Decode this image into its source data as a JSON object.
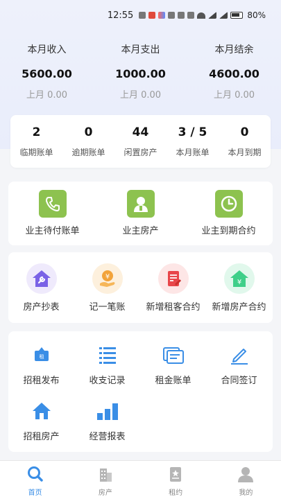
{
  "status_bar": {
    "time": "12:55",
    "battery": "80%"
  },
  "summary": [
    {
      "label": "本月收入",
      "amount": "5600.00",
      "last": "上月 0.00"
    },
    {
      "label": "本月支出",
      "amount": "1000.00",
      "last": "上月 0.00"
    },
    {
      "label": "本月结余",
      "amount": "4600.00",
      "last": "上月 0.00"
    }
  ],
  "stats": [
    {
      "value": "2",
      "label": "临期账单"
    },
    {
      "value": "0",
      "label": "逾期账单"
    },
    {
      "value": "44",
      "label": "闲置房产"
    },
    {
      "value": "3 / 5",
      "label": "本月账单"
    },
    {
      "value": "0",
      "label": "本月到期"
    }
  ],
  "owner_actions": [
    {
      "label": "业主待付账单",
      "icon": "phone-icon"
    },
    {
      "label": "业主房产",
      "icon": "person-icon"
    },
    {
      "label": "业主到期合约",
      "icon": "clock-icon"
    }
  ],
  "quick_actions": [
    {
      "label": "房产抄表",
      "icon": "house-wrench-icon",
      "color": "#7a62e6"
    },
    {
      "label": "记一笔账",
      "icon": "yen-hand-icon",
      "color": "#f2a33a"
    },
    {
      "label": "新增租客合约",
      "icon": "contract-icon",
      "color": "#e8464a"
    },
    {
      "label": "新增房产合约",
      "icon": "house-yen-icon",
      "color": "#3fcf89"
    }
  ],
  "functions": [
    {
      "label": "招租发布",
      "icon": "rent-publish-icon"
    },
    {
      "label": "收支记录",
      "icon": "list-icon"
    },
    {
      "label": "租金账单",
      "icon": "bill-icon"
    },
    {
      "label": "合同签订",
      "icon": "pen-icon"
    },
    {
      "label": "招租房产",
      "icon": "home-icon"
    },
    {
      "label": "经营报表",
      "icon": "bar-chart-icon"
    }
  ],
  "tabbar": [
    {
      "label": "首页",
      "active": true
    },
    {
      "label": "房产",
      "active": false
    },
    {
      "label": "租约",
      "active": false
    },
    {
      "label": "我的",
      "active": false
    }
  ],
  "colors": {
    "accent_blue": "#3a8ee6",
    "owner_green": "#8dc24f"
  }
}
